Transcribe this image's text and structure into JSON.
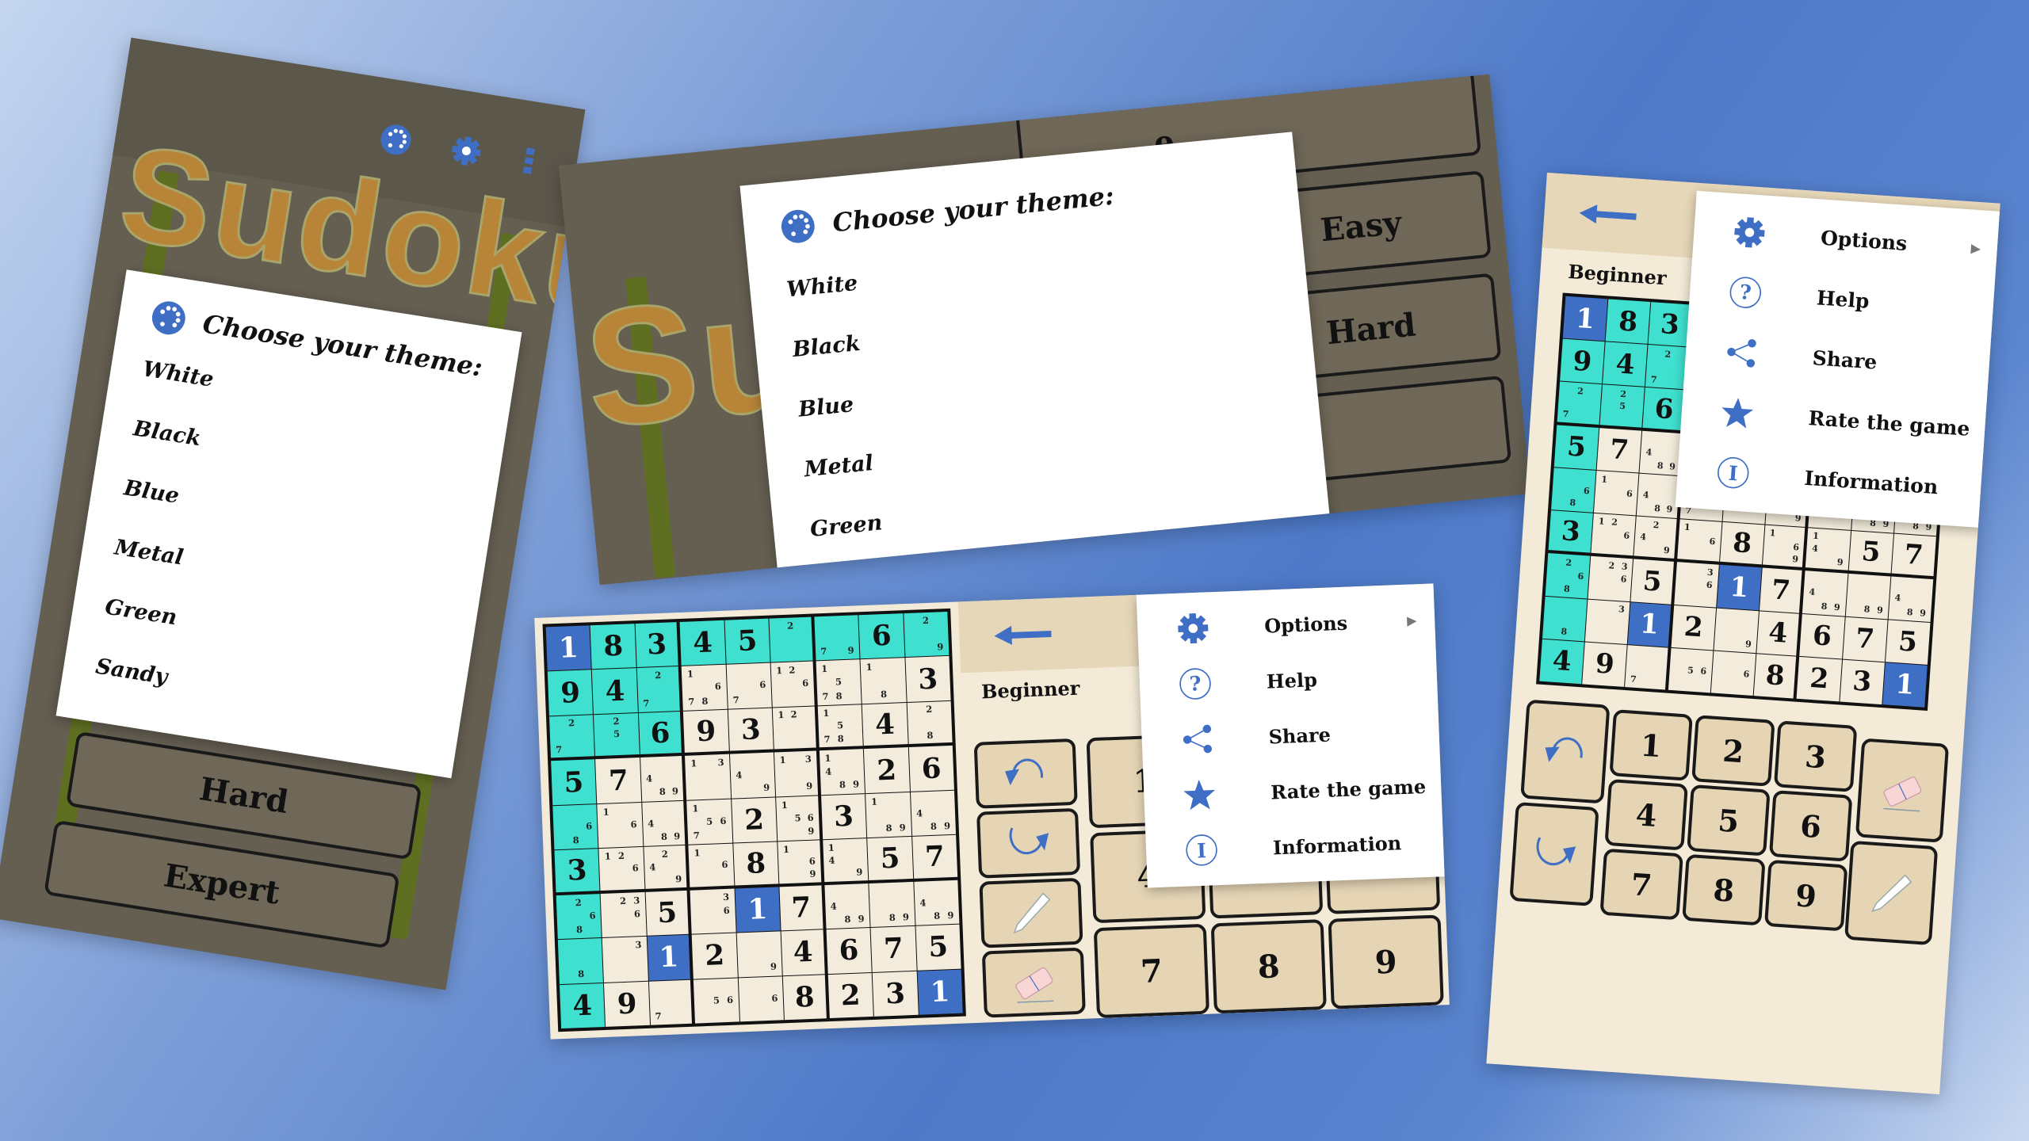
{
  "colors": {
    "accent_blue": "#3f6fc4",
    "highlight_cyan": "#3fe0cf",
    "cell_bg": "#f3ecdc",
    "button_beige": "#e5d5b5",
    "logo_orange": "#e8a040"
  },
  "home": {
    "logo": "Sudoku",
    "buttons": [
      "Easy",
      "Hard",
      "Expert"
    ],
    "partial_button_text": "e",
    "toolbar_icons": [
      "palette-icon",
      "gear-icon",
      "more-vertical-icon"
    ]
  },
  "theme_dialog": {
    "title": "Choose your theme:",
    "icon": "palette-icon",
    "options": [
      "White",
      "Black",
      "Blue",
      "Metal",
      "Green",
      "Sandy"
    ]
  },
  "game": {
    "level": "Beginner",
    "back_icon": "arrow-left-icon",
    "controls": [
      "undo-icon",
      "redo-icon",
      "pencil-icon",
      "eraser-icon"
    ],
    "digits": [
      "1",
      "2",
      "3",
      "4",
      "5",
      "6",
      "7",
      "8",
      "9"
    ],
    "menu": [
      {
        "label": "Options",
        "icon": "gear-icon",
        "submenu": true
      },
      {
        "label": "Help",
        "icon": "help-circle-icon"
      },
      {
        "label": "Share",
        "icon": "share-icon"
      },
      {
        "label": "Rate the game",
        "icon": "star-icon"
      },
      {
        "label": "Information",
        "icon": "info-icon"
      }
    ],
    "selected_value": "1",
    "cells": [
      [
        "1",
        "8",
        "3",
        "4",
        "5",
        "",
        "",
        "6",
        ""
      ],
      [
        "9",
        "4",
        "",
        "",
        "",
        "",
        "",
        "",
        "3"
      ],
      [
        "",
        "",
        "6",
        "9",
        "3",
        "",
        "",
        "4",
        ""
      ],
      [
        "5",
        "7",
        "",
        "",
        "",
        "",
        "",
        "2",
        "6"
      ],
      [
        "",
        "",
        "",
        "",
        "2",
        "",
        "3",
        "",
        ""
      ],
      [
        "3",
        "",
        "",
        "",
        "8",
        "",
        "",
        "5",
        "7"
      ],
      [
        "",
        "",
        "5",
        "",
        "1",
        "7",
        "",
        "",
        ""
      ],
      [
        "",
        "",
        "1",
        "2",
        "",
        "4",
        "6",
        "7",
        "5"
      ],
      [
        "4",
        "9",
        "",
        "",
        "",
        "8",
        "2",
        "3",
        "1"
      ]
    ],
    "candidates": [
      [
        "",
        "",
        "",
        "",
        "",
        "2",
        "79",
        "",
        "29"
      ],
      [
        "",
        "",
        "27",
        "1678",
        "67",
        "126",
        "1578",
        "18",
        ""
      ],
      [
        "27",
        "25",
        "",
        "",
        "",
        "12",
        "1578",
        "",
        "28"
      ],
      [
        "",
        "",
        "489",
        "13",
        "49",
        "139",
        "1489",
        "",
        ""
      ],
      [
        "68",
        "16",
        "489",
        "1567",
        "",
        "1569",
        "",
        "189",
        "489"
      ],
      [
        "",
        "126",
        "249",
        "16",
        "",
        "169",
        "149",
        "",
        ""
      ],
      [
        "268",
        "236",
        "",
        "36",
        "",
        "",
        "489",
        "89",
        "489"
      ],
      [
        "8",
        "3",
        "",
        "",
        "9",
        "",
        "",
        "",
        ""
      ],
      [
        "",
        "",
        "7",
        "56",
        "6",
        "",
        "",
        "",
        ""
      ]
    ]
  }
}
